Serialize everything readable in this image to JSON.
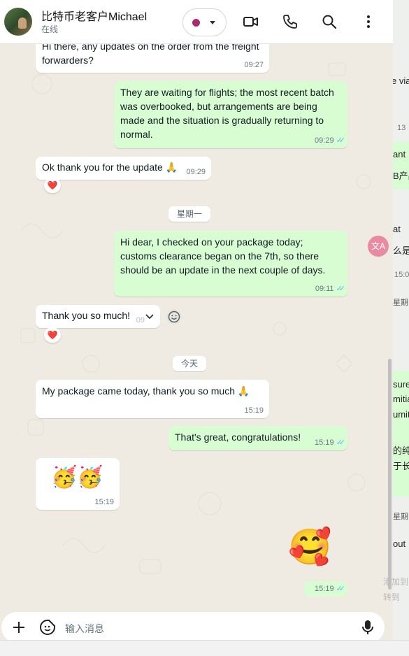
{
  "header": {
    "contact_name": "比特币老客户Michael",
    "status": "在线"
  },
  "messages": [
    {
      "text": "Hi there, any updates on the order from the freight forwarders?",
      "time": "09:27"
    },
    {
      "text": "They are waiting for flights; the most recent batch was overbooked, but arrangements are being made and the situation is gradually returning to normal.",
      "time": "09:29"
    },
    {
      "text": "Ok thank you for the update 🙏",
      "time": "09:29",
      "reaction": "❤️"
    },
    {
      "text": "Hi dear, I checked on your package today; customs clearance began on the 7th, so there should be an update in the next couple of days.",
      "time": "09:11"
    },
    {
      "text": "Thank you so much!",
      "time": "09",
      "reaction": "❤️"
    },
    {
      "text": "My package came today, thank you so much 🙏",
      "time": "15:19"
    },
    {
      "text": "That's great, congratulations!",
      "time": "15:19"
    },
    {
      "text": "🥳🥳",
      "time": "15:19"
    },
    {
      "text": "🥰",
      "time": "15:19"
    }
  ],
  "date_chips": {
    "monday": "星期一",
    "today": "今天"
  },
  "composer": {
    "placeholder": "输入消息"
  },
  "side_panel": {
    "fragments": [
      "e via",
      "13",
      "ant",
      "B产品",
      "at",
      "么是",
      "15:0",
      "星期",
      "sure",
      "mitia",
      "umit",
      "的纯",
      "于长",
      "星期",
      "out",
      "添加到",
      "转到"
    ]
  },
  "colors": {
    "incoming": "#ffffff",
    "outgoing": "#d9fdd3",
    "background": "#efeae2",
    "read_ticks": "#53bdeb"
  }
}
